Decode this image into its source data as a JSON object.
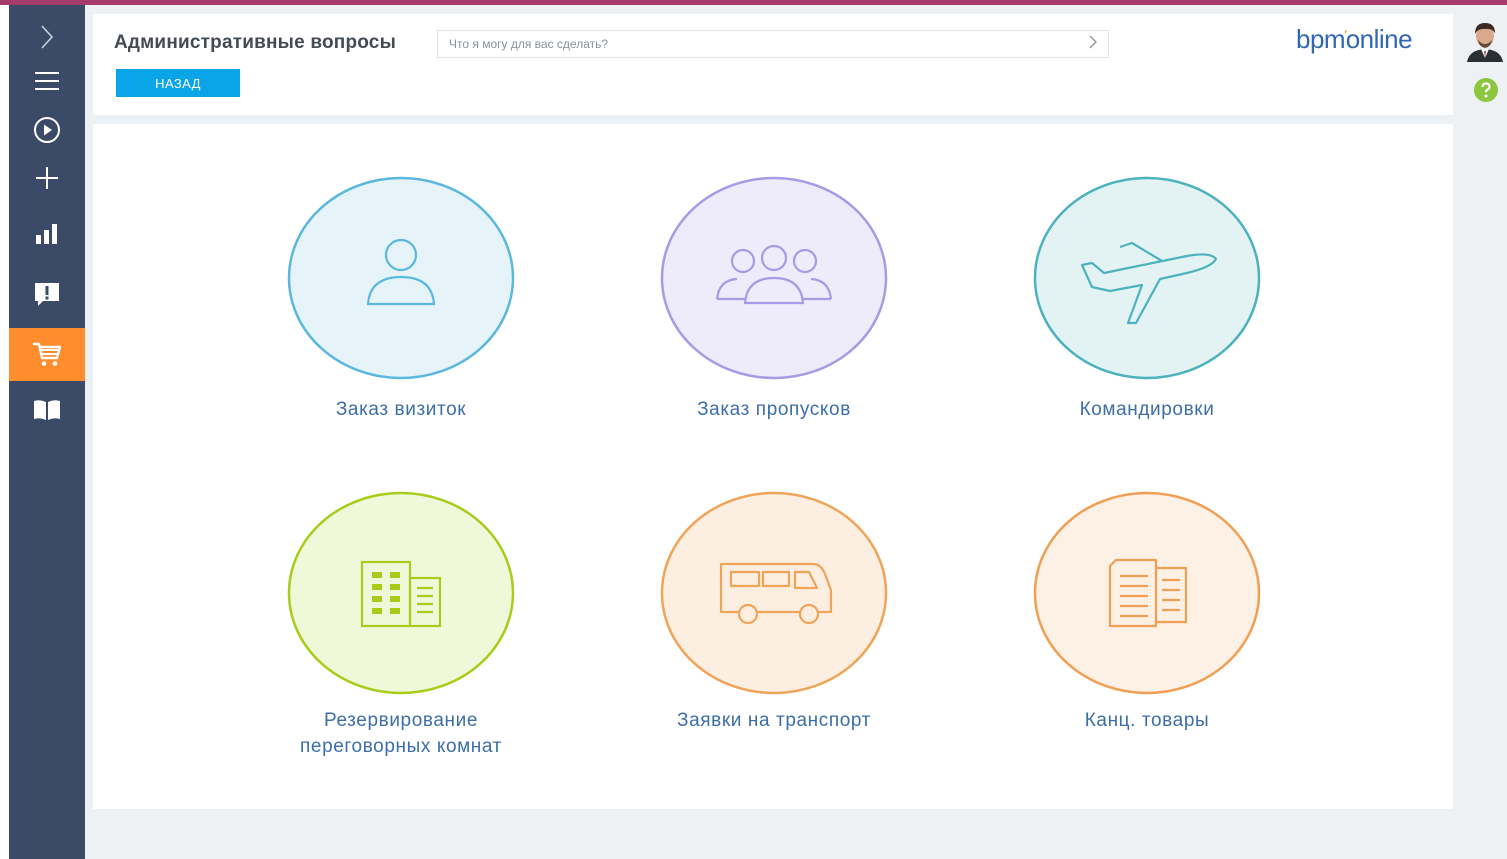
{
  "header": {
    "title": "Административные вопросы",
    "search_placeholder": "Что я могу для вас сделать?",
    "back_label": "НАЗАД",
    "logo_text_left": "bpm",
    "logo_text_right": "online"
  },
  "sidebar": {
    "items": [
      {
        "icon": "chevron-right-icon"
      },
      {
        "icon": "menu-icon"
      },
      {
        "icon": "play-circle-icon"
      },
      {
        "icon": "plus-icon"
      },
      {
        "icon": "bar-chart-icon"
      },
      {
        "icon": "alert-message-icon"
      },
      {
        "icon": "cart-icon",
        "active": true
      },
      {
        "icon": "book-icon"
      }
    ],
    "active_color": "#ff8d2d",
    "background": "#3b4a67"
  },
  "tiles": [
    {
      "label": "Заказ визиток",
      "icon": "person-icon",
      "color": "#5ab8de",
      "fill": "#e6f4fa"
    },
    {
      "label": "Заказ пропусков",
      "icon": "group-icon",
      "color": "#a99ae6",
      "fill": "#eeebfa"
    },
    {
      "label": "Командировки",
      "icon": "airplane-icon",
      "color": "#4cb2bd",
      "fill": "#e3f3f4"
    },
    {
      "label_line1": "Резервирование",
      "label_line2": "переговорных комнат",
      "icon": "building-icon",
      "color": "#a8cc19",
      "fill": "#f1f8d9"
    },
    {
      "label": "Заявки на транспорт",
      "icon": "bus-icon",
      "color": "#efa458",
      "fill": "#fcefe2"
    },
    {
      "label": "Канц. товары",
      "icon": "documents-icon",
      "color": "#f19f55",
      "fill": "#fdf0e4"
    }
  ],
  "colors": {
    "accent_bar": "#a53a6b",
    "back_button": "#0aa5e9",
    "logo": "#3067b4",
    "help": "#8cc63f"
  }
}
